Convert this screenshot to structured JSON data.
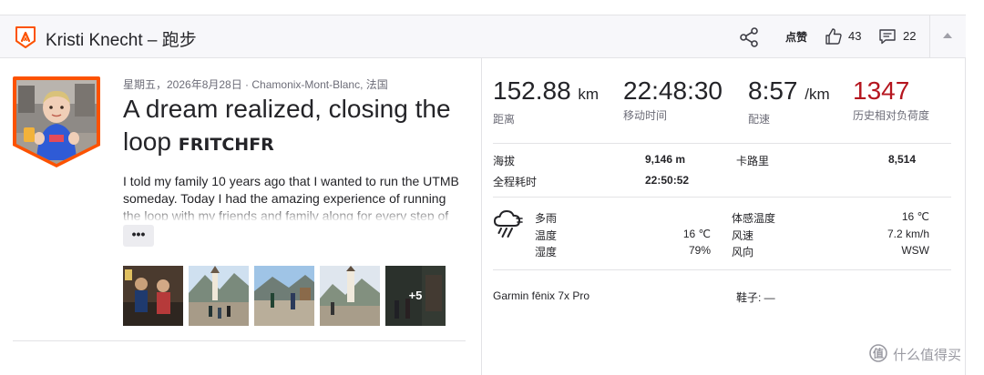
{
  "header": {
    "title": "Kristi Knecht – 跑步",
    "kudos_label": "点赞",
    "likes_count": "43",
    "comments_count": "22",
    "icons": [
      "strava-logo-icon",
      "share-icon",
      "thumbs-up-icon",
      "comment-icon",
      "collapse-chevron-icon"
    ]
  },
  "activity": {
    "meta": "星期五，2026年8月28日 · Chamonix-Mont-Blanc, 法国",
    "title_text": "A dream realized, closing the loop",
    "title_tag": "FRITCHFR",
    "description": "I told my family 10 years ago that I wanted to run the UTMB someday. Today I had the amazing experience of running the loop with my friends and family along for every step of",
    "more_label": "•••",
    "photos_more": "+5"
  },
  "stats": {
    "distance": {
      "value": "152.88",
      "unit": "km",
      "label": "距离"
    },
    "moving_time": {
      "value": "22:48:30",
      "label": "移动时间"
    },
    "pace": {
      "value": "8:57",
      "unit": "/km",
      "label": "配速"
    },
    "relative_effort": {
      "value": "1347",
      "label": "历史相对负荷度",
      "color": "#b5161f"
    }
  },
  "details": {
    "elevation_label": "海拔",
    "elevation_value": "9,146 m",
    "calories_label": "卡路里",
    "calories_value": "8,514",
    "elapsed_label": "全程耗时",
    "elapsed_value": "22:50:52"
  },
  "weather": {
    "icon": "rain-cloud-icon",
    "condition_label": "多雨",
    "temp_label": "温度",
    "temp_value": "16 ℃",
    "humidity_label": "湿度",
    "humidity_value": "79%",
    "feels_label": "体感温度",
    "feels_value": "16 ℃",
    "wind_speed_label": "风速",
    "wind_speed_value": "7.2 km/h",
    "wind_dir_label": "风向",
    "wind_dir_value": "WSW"
  },
  "gear": {
    "device": "Garmin fēnix 7x Pro",
    "shoes": "鞋子: —"
  },
  "watermark": {
    "text": "什么值得买"
  },
  "colors": {
    "brand_orange": "#fc5200",
    "header_bg": "#f7f7fa",
    "text": "#242428",
    "muted": "#6d6d78",
    "relative_effort": "#b5161f"
  }
}
